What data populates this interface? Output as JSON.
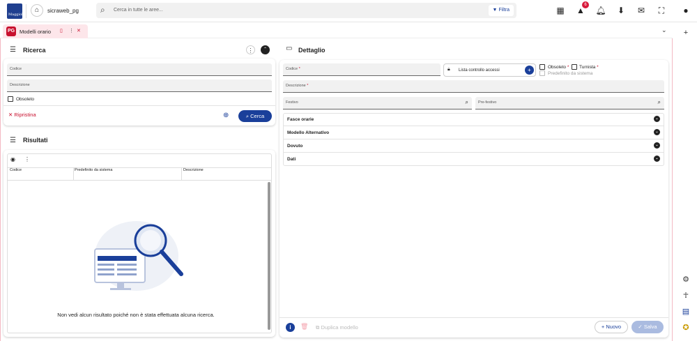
{
  "header": {
    "logo_text": "Maggioli",
    "app_name": "sicraweb_pg",
    "search_placeholder": "Cerca in tutte le aree...",
    "filter_label": "Filtra",
    "alert_count": "6"
  },
  "tab": {
    "icon_text": "PG",
    "label": "Modelli orario"
  },
  "ricerca": {
    "title": "Ricerca",
    "codice_label": "Codice",
    "descrizione_label": "Descrizione",
    "obsoleto_label": "Obsoleto",
    "ripristina_label": "Ripristina",
    "cerca_label": "Cerca"
  },
  "risultati": {
    "title": "Risultati",
    "columns": [
      "Codice",
      "Predefinito da sistema",
      "Descrizione"
    ],
    "empty_message": "Non vedi alcun risultato poiché non è stata effettuata alcuna ricerca."
  },
  "dettaglio": {
    "title": "Dettaglio",
    "codice_label": "Codice",
    "lista_label": "Lista controllo accessi",
    "obsoleto_label": "Obsoleto",
    "turnista_label": "Turnista",
    "predefinito_label": "Predefinito da sistema",
    "descrizione_label": "Descrizione",
    "festivo_label": "Festivo",
    "prefestivo_label": "Pre-festivo",
    "sections": [
      "Fasce orarie",
      "Modello Alternativo",
      "Dovuto",
      "Dati"
    ],
    "duplica_label": "Duplica modello",
    "nuovo_label": "Nuovo",
    "salva_label": "Salva"
  },
  "colors": {
    "primary": "#1a3f9a",
    "accent_red": "#c8102e"
  }
}
